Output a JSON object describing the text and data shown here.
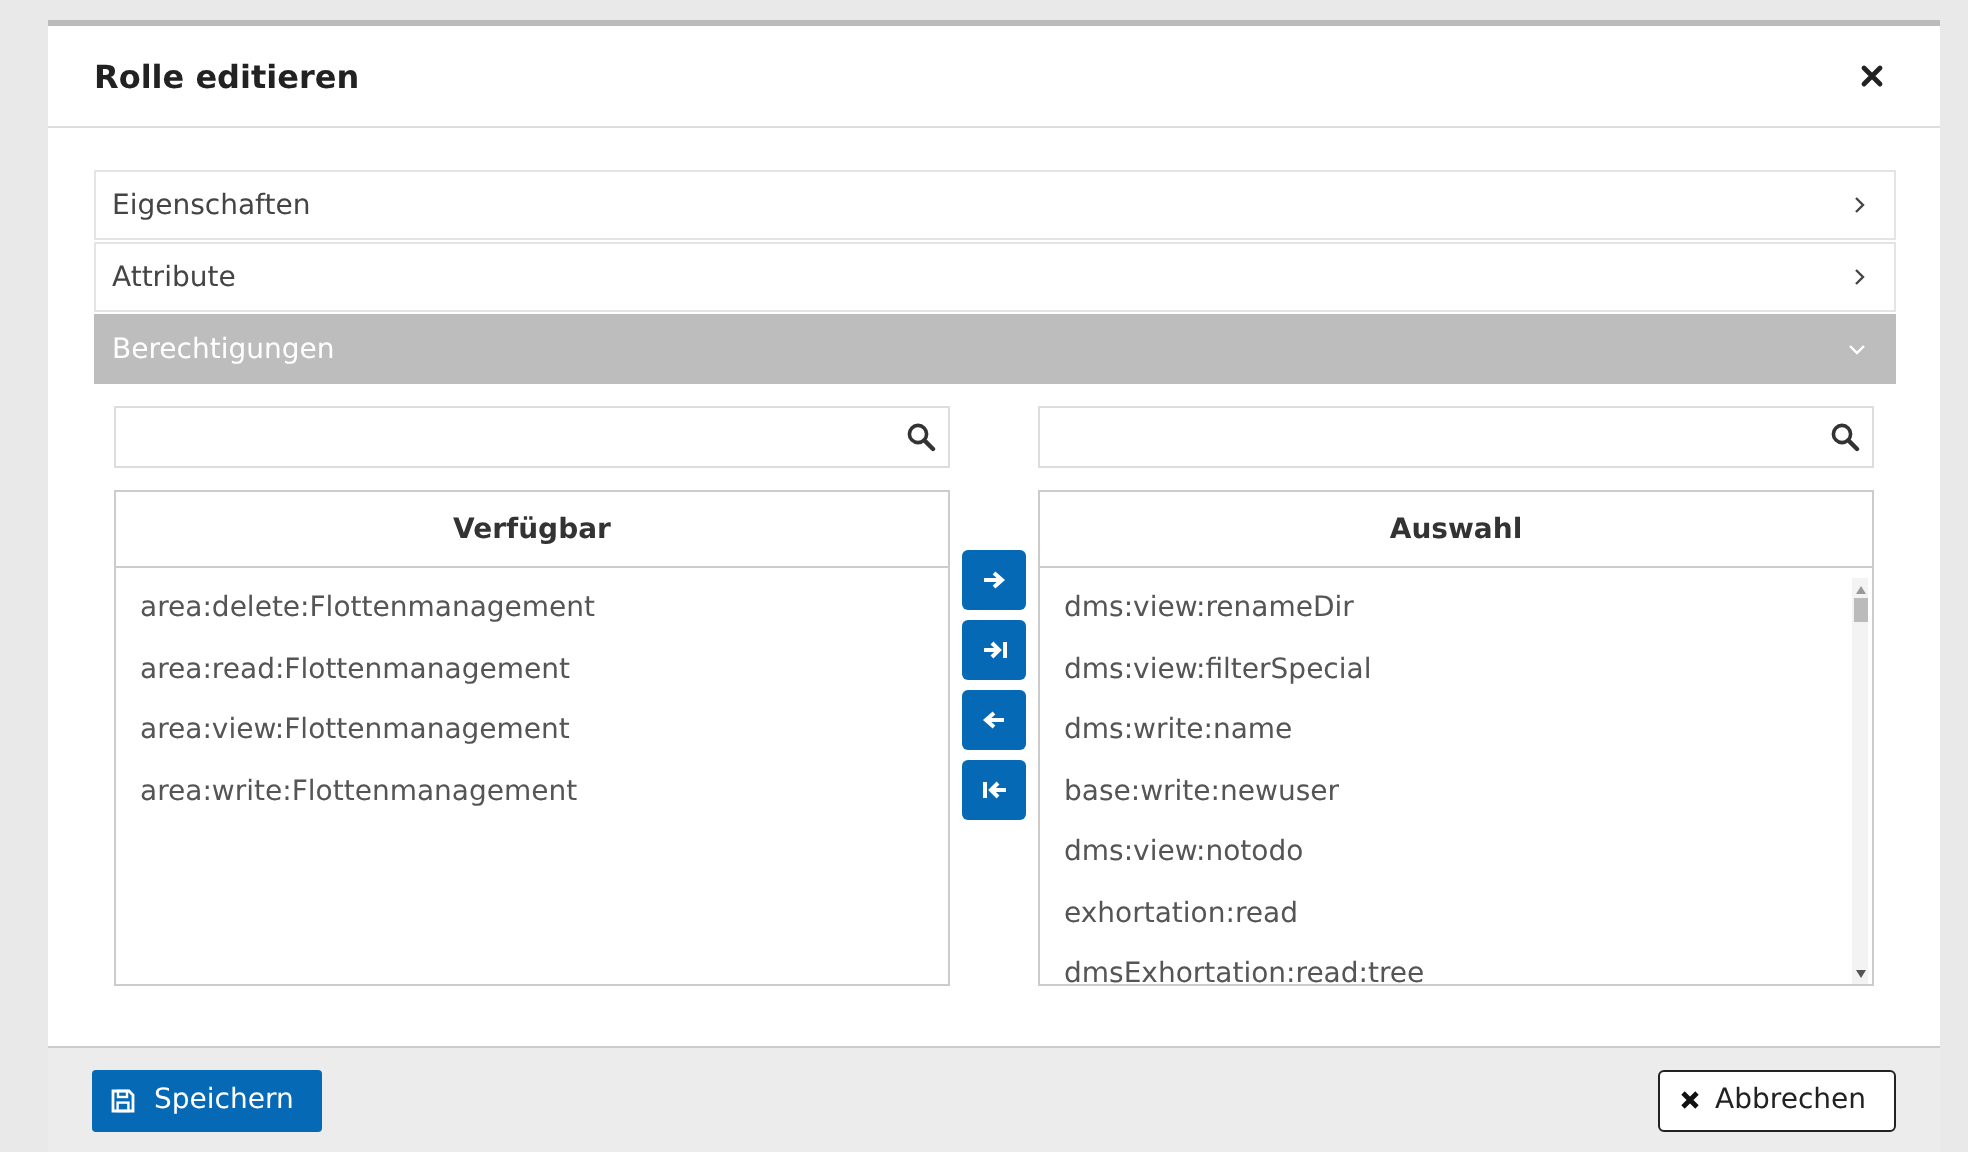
{
  "dialog": {
    "title": "Rolle editieren"
  },
  "panels": [
    {
      "label": "Eigenschaften",
      "expanded": false
    },
    {
      "label": "Attribute",
      "expanded": false
    },
    {
      "label": "Berechtigungen",
      "expanded": true
    }
  ],
  "available": {
    "header": "Verfügbar",
    "items": [
      "area:delete:Flottenmanagement",
      "area:read:Flottenmanagement",
      "area:view:Flottenmanagement",
      "area:write:Flottenmanagement"
    ]
  },
  "selection": {
    "header": "Auswahl",
    "items": [
      "dms:view:renameDir",
      "dms:view:filterSpecial",
      "dms:write:name",
      "base:write:newuser",
      "dms:view:notodo",
      "exhortation:read",
      "dmsExhortation:read:tree"
    ]
  },
  "footer": {
    "save": "Speichern",
    "cancel": "Abbrechen"
  }
}
